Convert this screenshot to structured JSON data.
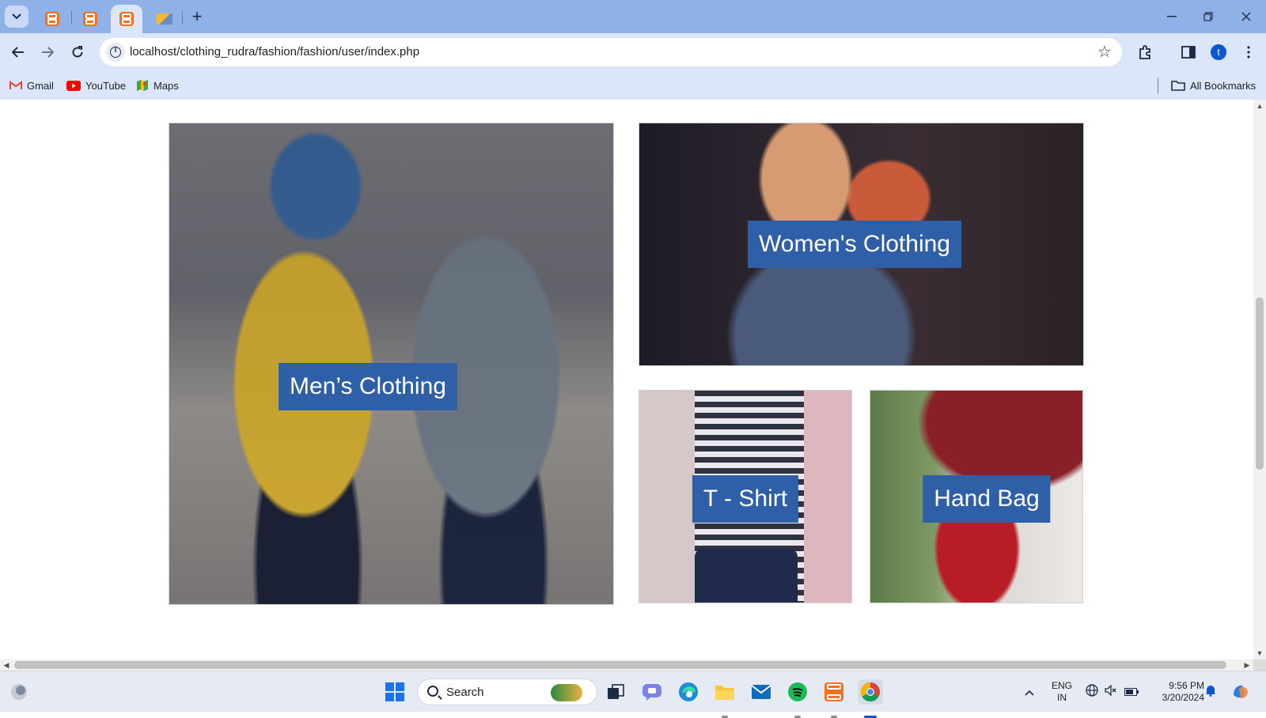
{
  "browser": {
    "tabs": [
      {
        "icon": "xampp-icon"
      },
      {
        "icon": "xampp-icon"
      },
      {
        "icon": "xampp-icon",
        "active": true
      },
      {
        "icon": "phpmyadmin-icon"
      }
    ],
    "new_tab": "+",
    "url": "localhost/clothing_rudra/fashion/fashion/user/index.php",
    "profile_initial": "t",
    "bookmarks": [
      {
        "label": "Gmail",
        "icon": "gmail-icon"
      },
      {
        "label": "YouTube",
        "icon": "youtube-icon"
      },
      {
        "label": "Maps",
        "icon": "maps-icon"
      }
    ],
    "all_bookmarks": "All Bookmarks"
  },
  "page": {
    "categories": [
      {
        "label": "Men’s Clothing"
      },
      {
        "label": "Women's Clothing"
      },
      {
        "label": "T - Shirt"
      },
      {
        "label": "Hand Bag"
      }
    ]
  },
  "taskbar": {
    "search_placeholder": "Search",
    "language": "ENG",
    "region": "IN",
    "time": "9:56 PM",
    "date": "3/20/2024"
  },
  "colors": {
    "label_bg": "#2f5fa7",
    "tab_strip": "#8eb1e8",
    "toolbar": "#dbe6fb"
  }
}
